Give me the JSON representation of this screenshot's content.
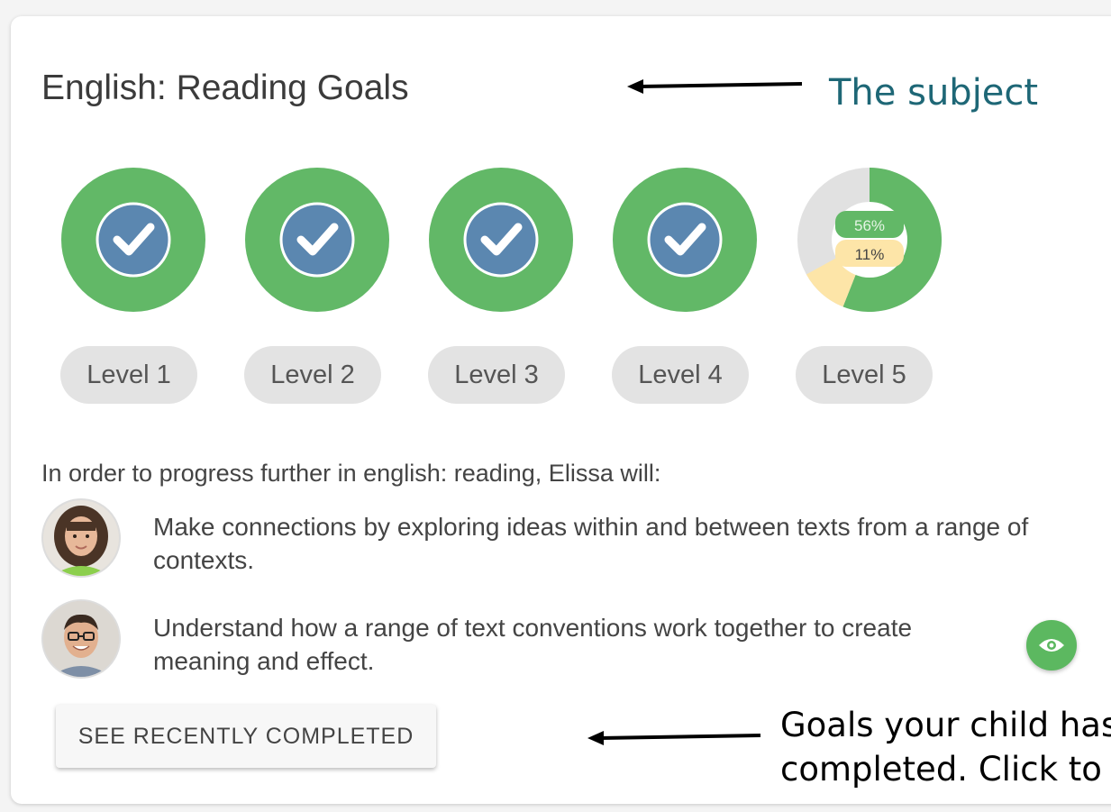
{
  "card": {
    "title": "English: Reading Goals",
    "levels": [
      {
        "label": "Level 1",
        "status": "completed"
      },
      {
        "label": "Level 2",
        "status": "completed"
      },
      {
        "label": "Level 3",
        "status": "completed"
      },
      {
        "label": "Level 4",
        "status": "completed"
      },
      {
        "label": "Level 5",
        "status": "in-progress",
        "achieved_percent": 56,
        "working_percent": 11,
        "achieved_label": "56%",
        "working_label": "11%"
      }
    ],
    "intro": "In order to progress further in english: reading, Elissa will:",
    "goals": [
      {
        "text": "Make connections by exploring ideas within and between texts from a range of contexts.",
        "avatar": "student-avatar"
      },
      {
        "text": "Understand how a range of text conventions work together to create meaning and effect.",
        "avatar": "teacher-avatar"
      }
    ],
    "view_icon": "eye-icon",
    "recent_button_label": "SEE RECENTLY COMPLETED"
  },
  "annotations": {
    "subject_label": "The subject",
    "goals_note_line1": "Goals your child has",
    "goals_note_line2": "completed. Click to"
  },
  "colors": {
    "completed_green": "#62b867",
    "check_blue": "#5b87b0",
    "pending_grey": "#e1e1e1",
    "working_yellow": "#fde5a8",
    "annotation_teal": "#1e6776"
  }
}
